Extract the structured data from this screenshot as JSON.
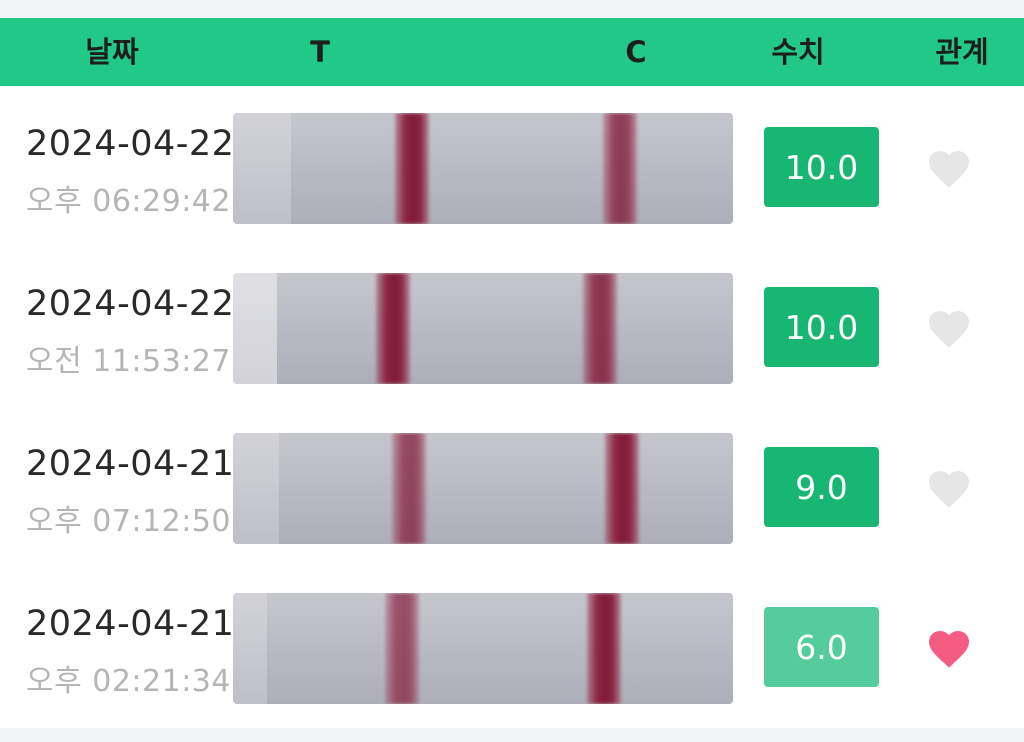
{
  "header": {
    "date_label": "날짜",
    "t_label": "T",
    "c_label": "C",
    "value_label": "수치",
    "relation_label": "관계"
  },
  "records": [
    {
      "date": "2024-04-22",
      "time": "오후 06:29:42",
      "value": "10.0",
      "value_color": "#17b673",
      "heart": "heart-icon",
      "heart_color": "#e6e6e6",
      "liked": false
    },
    {
      "date": "2024-04-22",
      "time": "오전 11:53:27",
      "value": "10.0",
      "value_color": "#17b673",
      "heart": "heart-icon",
      "heart_color": "#e6e6e6",
      "liked": false
    },
    {
      "date": "2024-04-21",
      "time": "오후 07:12:50",
      "value": "9.0",
      "value_color": "#17b673",
      "heart": "heart-icon",
      "heart_color": "#e6e6e6",
      "liked": false
    },
    {
      "date": "2024-04-21",
      "time": "오후 02:21:34",
      "value": "6.0",
      "value_color": "#54cc9b",
      "heart": "heart-icon",
      "heart_color": "#f45c82",
      "liked": true
    }
  ]
}
